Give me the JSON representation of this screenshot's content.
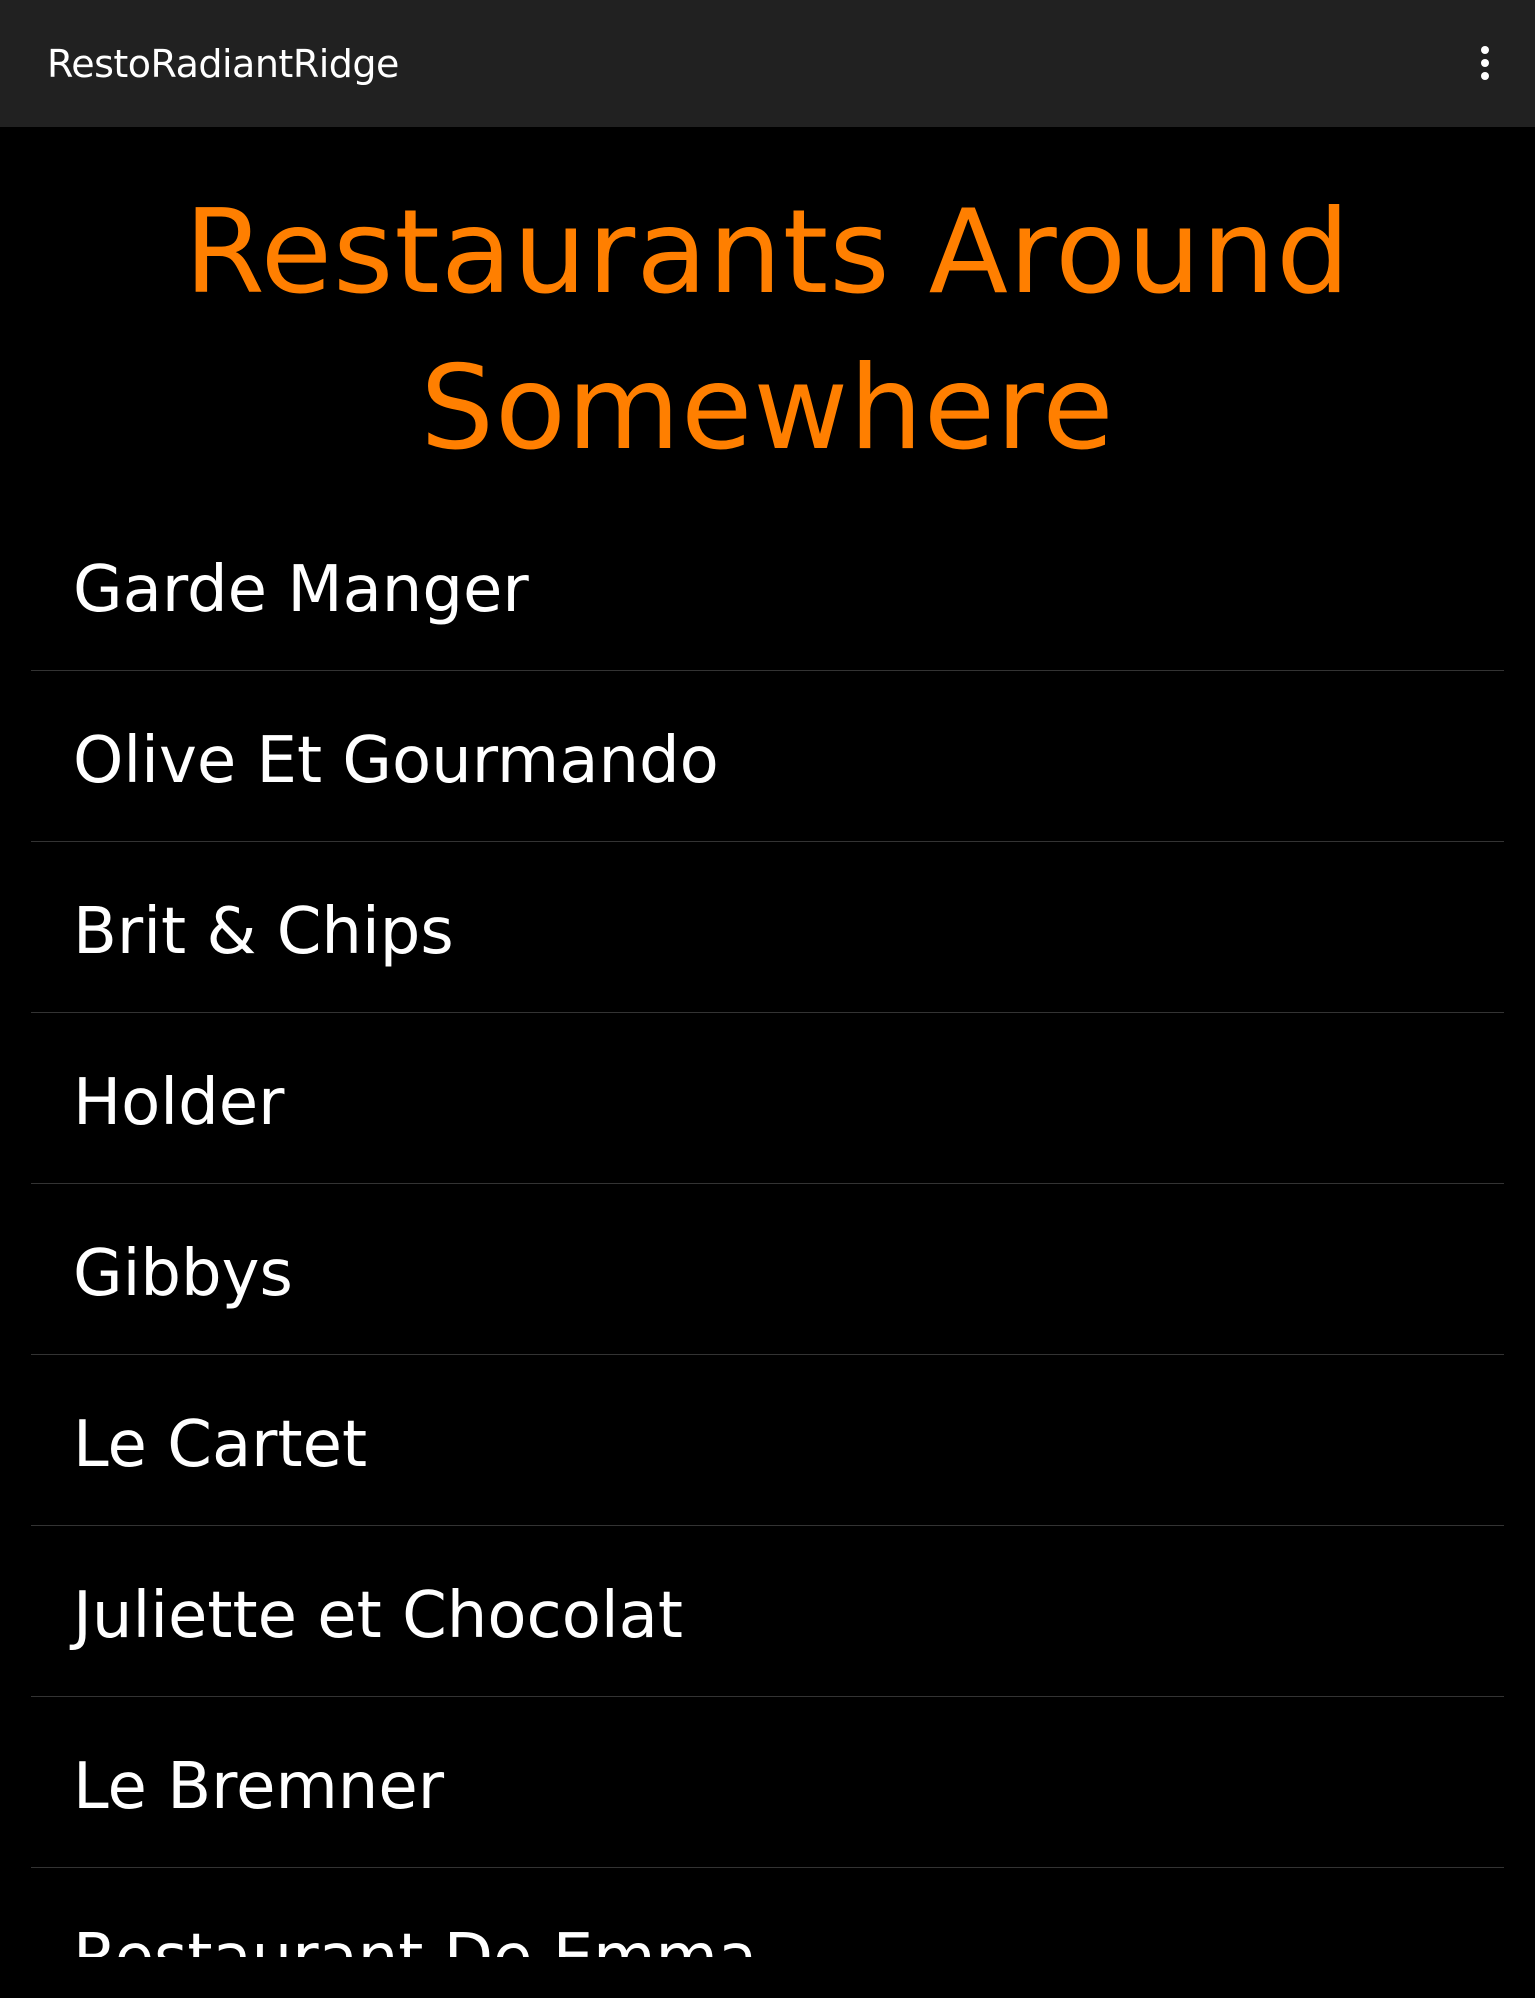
{
  "app_bar": {
    "title": "RestoRadiantRidge",
    "overflow_icon": "more-vertical-icon"
  },
  "main": {
    "heading": "Restaurants Around Somewhere",
    "restaurants": [
      "Garde Manger",
      "Olive Et Gourmando",
      "Brit & Chips",
      "Holder",
      "Gibbys",
      "Le Cartet",
      "Juliette et Chocolat",
      "Le Bremner",
      "Restaurant De Emma"
    ]
  },
  "colors": {
    "background": "#000000",
    "app_bar": "#212121",
    "heading": "#ff7f00",
    "text": "#ffffff",
    "divider": "#333333"
  }
}
